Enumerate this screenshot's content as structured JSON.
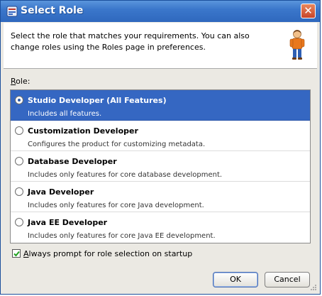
{
  "window": {
    "title": "Select Role",
    "close_glyph": "✕",
    "title_icon": "window-icon"
  },
  "header": {
    "text": "Select the role that matches your requirements. You can also change roles using the Roles page in preferences.",
    "icon": "person-icon"
  },
  "role_label": {
    "accel": "R",
    "rest": "ole:"
  },
  "roles": [
    {
      "name": "Studio Developer (All Features)",
      "description": "Includes all features.",
      "selected": true
    },
    {
      "name": "Customization Developer",
      "description": "Configures the product for customizing metadata.",
      "selected": false
    },
    {
      "name": "Database Developer",
      "description": "Includes only features for core database development.",
      "selected": false
    },
    {
      "name": "Java Developer",
      "description": "Includes only features for core Java development.",
      "selected": false
    },
    {
      "name": "Java EE Developer",
      "description": "Includes only features for core Java EE development.",
      "selected": false
    }
  ],
  "always_prompt": {
    "accel": "A",
    "rest": "lways prompt for role selection on startup",
    "checked": true
  },
  "buttons": {
    "ok": "OK",
    "cancel": "Cancel"
  },
  "colors": {
    "selection": "#3567c2",
    "titlebar": "#3b77cb"
  }
}
